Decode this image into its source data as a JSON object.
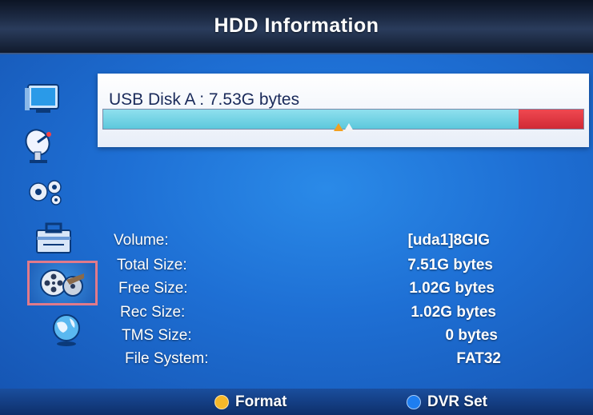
{
  "window": {
    "title": "HDD Information"
  },
  "sidebar": {
    "items": [
      {
        "icon": "tv-icon"
      },
      {
        "icon": "satellite-dish-icon"
      },
      {
        "icon": "gears-icon"
      },
      {
        "icon": "toolbox-icon"
      },
      {
        "icon": "film-reel-icon",
        "selected": true
      },
      {
        "icon": "globe-icon"
      }
    ]
  },
  "disk": {
    "label": "USB Disk A : 7.53G bytes",
    "used_fraction": 0.865,
    "free_fraction": 0.135,
    "used_color": "#6cd2e4",
    "free_color": "#e03a44"
  },
  "info": {
    "rows": [
      {
        "label": "Volume:",
        "value": "[uda1]8GIG"
      },
      {
        "label": "Total Size:",
        "value": "7.51G bytes"
      },
      {
        "label": "Free Size:",
        "value": "1.02G bytes"
      },
      {
        "label": "Rec Size:",
        "value": "1.02G bytes"
      },
      {
        "label": "TMS Size:",
        "value": "0 bytes"
      },
      {
        "label": "File System:",
        "value": "FAT32"
      }
    ]
  },
  "footer": {
    "format": {
      "label": "Format",
      "color": "#f5b82a"
    },
    "dvr_set": {
      "label": "DVR Set",
      "color": "#1e7ef0"
    }
  }
}
